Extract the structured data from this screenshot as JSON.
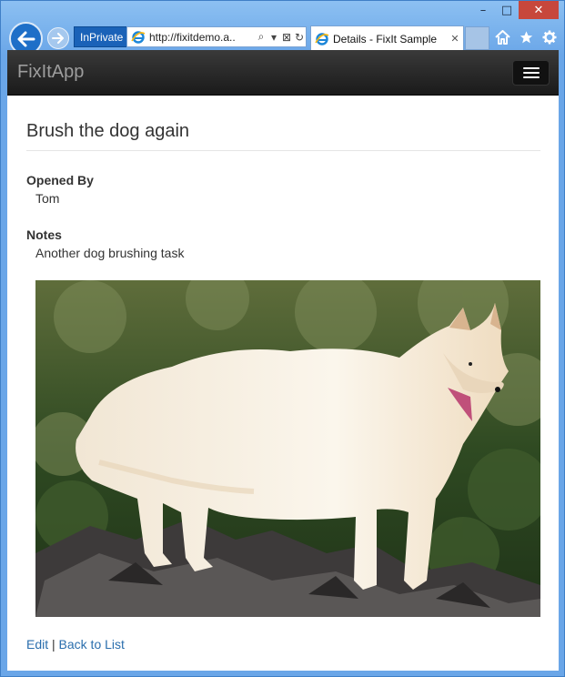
{
  "browser": {
    "inprivate_label": "InPrivate",
    "address_url": "http://fixitdemo.a..",
    "tab_title": "Details - FixIt Sample"
  },
  "navbar": {
    "brand": "FixItApp"
  },
  "details": {
    "title": "Brush the dog again",
    "opened_by_label": "Opened By",
    "opened_by_value": "Tom",
    "notes_label": "Notes",
    "notes_value": "Another dog brushing task"
  },
  "footer_links": {
    "edit": "Edit",
    "separator": "|",
    "back": "Back to List"
  },
  "colors": {
    "link": "#2a6ead",
    "navbar_bg": "#1f1f1f",
    "brand_text": "#9d9d9d",
    "window_frame": "#6aa6e8",
    "close_button": "#c7473c"
  },
  "icons": [
    "back-arrow-icon",
    "forward-arrow-icon",
    "ie-logo-icon",
    "search-icon",
    "dropdown-icon",
    "compat-view-icon",
    "refresh-icon",
    "close-tab-icon",
    "home-icon",
    "favorites-star-icon",
    "settings-gear-icon",
    "hamburger-menu-icon",
    "minimize-icon",
    "maximize-icon",
    "close-icon"
  ]
}
